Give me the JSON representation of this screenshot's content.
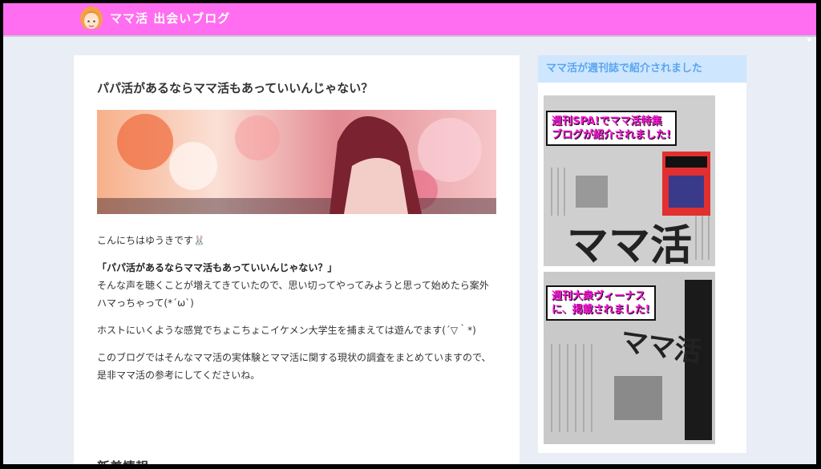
{
  "header": {
    "site_title": "ママ活 出会いブログ",
    "brand_color": "#ff6ef0",
    "avatar_icon": "girl-avatar-icon"
  },
  "article": {
    "title": "パパ活があるならママ活もあっていいんじゃない？",
    "paragraphs": {
      "greeting": "こんにちはゆうきです🐰",
      "quote": "「パパ活があるならママ活もあっていいんじゃない？」",
      "p2": "そんな声を聴くことが増えてきていたので、思い切ってやってみようと思って始めたら案外ハマっちゃって(*´ω`)",
      "p3": "ホストにいくような感覚でちょこちょこイケメン大学生を捕まえては遊んでます(´▽｀*)",
      "p4": "このブログではそんなママ活の実体験とママ活に関する現状の調査をまとめていますので、是非ママ活の参考にしてくださいね。"
    },
    "news_heading": "新着情報"
  },
  "sidebar": {
    "widget_title": "ママ活が週刊誌で紹介されました",
    "widget_title_color": "#5aa6ef",
    "magazines": [
      {
        "callout_line1": "週刊SPA!でママ活特集",
        "callout_line2": "ブログが紹介されました!",
        "big_text": "ママ活"
      },
      {
        "callout_line1": "週刊大衆ヴィーナス",
        "callout_line2": "に、掲載されました!",
        "big_text": "ママ活"
      }
    ],
    "callout_color": "#ff16dc"
  }
}
